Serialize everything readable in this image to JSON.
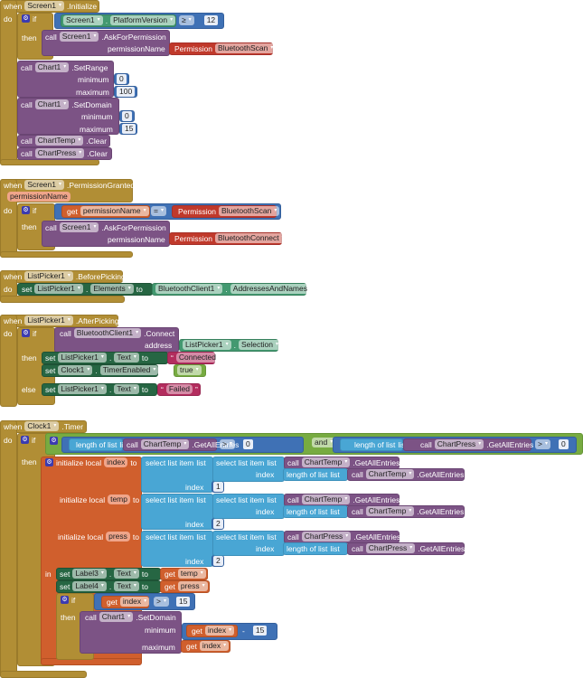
{
  "kw": {
    "when": "when",
    "do": "do",
    "if": "if",
    "then": "then",
    "else": "else",
    "call": "call",
    "set": "set",
    "to": "to",
    "get": "get",
    "in": "in",
    "dot": ".",
    "minimum": "minimum",
    "maximum": "maximum",
    "address": "address",
    "permissionName": "permissionName",
    "Permission": "Permission",
    "length_of_list": "length of list",
    "list": "list",
    "select_list_item": "select list item",
    "index": "index",
    "initialize_local": "initialize local",
    "gte": "≥",
    "gt": ">",
    "eq": "=",
    "and": "and",
    "minus": "-",
    "gear": "⚙",
    "arrow": "▾",
    "quote": "“",
    "quote_end": "”"
  },
  "ev1": {
    "comp": "Screen1",
    "event": ".Initialize",
    "prop": "PlatformVersion",
    "version": "12",
    "method": ".AskForPermission",
    "perm": "BluetoothScan",
    "chart": "Chart1",
    "setRange": ".SetRange",
    "range_min": "0",
    "range_max": "100",
    "setDomain": ".SetDomain",
    "dom_min": "0",
    "dom_max": "15",
    "chartTemp": "ChartTemp",
    "chartPress": "ChartPress",
    "clear": ".Clear"
  },
  "ev2": {
    "comp": "Screen1",
    "event": ".PermissionGranted",
    "param": "permissionName",
    "perm1": "BluetoothScan",
    "method": ".AskForPermission",
    "perm2": "BluetoothConnect"
  },
  "ev3": {
    "comp": "ListPicker1",
    "event": ".BeforePicking",
    "prop": "Elements",
    "bt": "BluetoothClient1",
    "btprop": "AddressesAndNames"
  },
  "ev4": {
    "comp": "ListPicker1",
    "event": ".AfterPicking",
    "bt": "BluetoothClient1",
    "connect": ".Connect",
    "selection": "Selection",
    "text": "Text",
    "connected": "Connected",
    "clock": "Clock1",
    "timerEnabled": "TimerEnabled",
    "true": "true",
    "failed": "Failed"
  },
  "ev5": {
    "comp": "Clock1",
    "event": ".Timer",
    "chartTemp": "ChartTemp",
    "chartPress": "ChartPress",
    "getAll": ".GetAllEntries",
    "zero": "0",
    "v_index": "index",
    "v_temp": "temp",
    "v_press": "press",
    "one": "1",
    "two": "2",
    "label3": "Label3",
    "label4": "Label4",
    "text": "Text",
    "fifteen": "15",
    "chart": "Chart1",
    "setDomain": ".SetDomain"
  }
}
